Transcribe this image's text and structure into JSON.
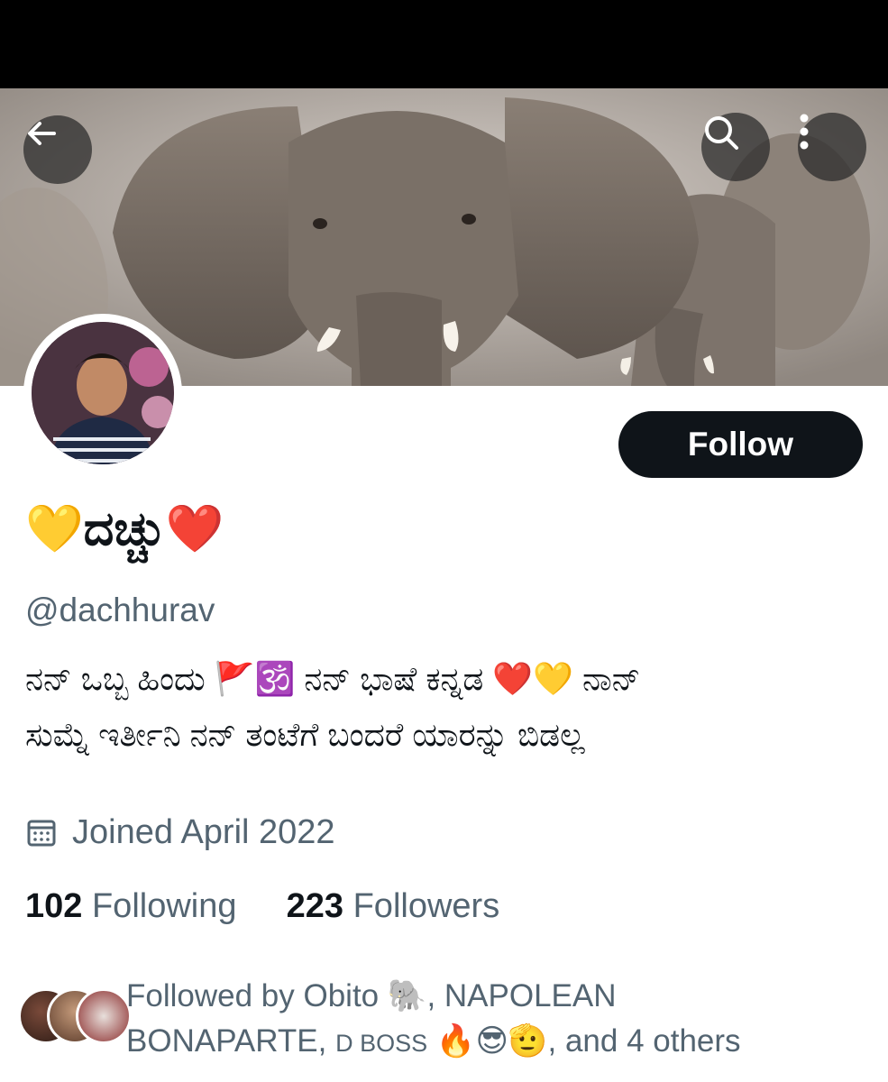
{
  "header": {
    "back_icon": "arrow-left-icon",
    "search_icon": "search-icon",
    "more_icon": "more-vertical-icon"
  },
  "profile": {
    "display_name": "💛ದಚ್ಚು❤️",
    "handle": "@dachhurav",
    "follow_label": "Follow",
    "bio_line1": "ನನ್ ಒಬ್ಬ ಹಿಂದು 🚩🕉️ ನನ್ ಭಾಷೆ ಕನ್ನಡ ❤️💛 ನಾನ್",
    "bio_line2": "ಸುಮ್ನೆ ಇರ್ತೀನಿ ನನ್ ತಂಟೆಗೆ ಬಂದರೆ  ಯಾರನ್ನು ಬಿಡಲ್ಲ",
    "joined": "Joined April 2022",
    "following_count": "102",
    "following_label": "Following",
    "followers_count": "223",
    "followers_label": "Followers",
    "followed_by_part1": "Followed by Obito 🐘, NAPOLEAN",
    "followed_by_part2": "BONAPARTE, ",
    "followed_by_part3": "D BOSS",
    "followed_by_part4": " 🔥😎🫡, and 4 others"
  },
  "colors": {
    "primary_text": "#0f1419",
    "secondary_text": "#536471",
    "follow_button_bg": "#0f1419",
    "status_bar": "#000000"
  }
}
